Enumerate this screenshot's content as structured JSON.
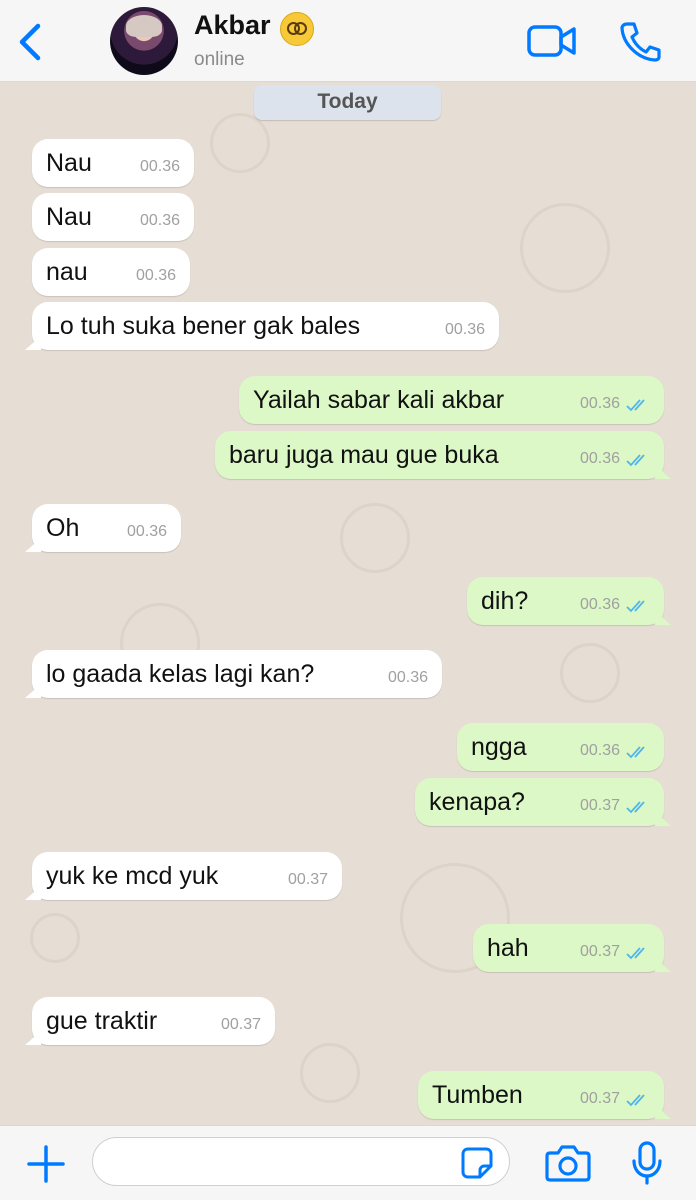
{
  "header": {
    "contact_name": "Akbar",
    "status": "online",
    "accent_color": "#007aff",
    "icons": [
      "chevron-left-icon",
      "avatar",
      "dizzy-face-emoji",
      "video-camera-icon",
      "phone-icon"
    ]
  },
  "chat": {
    "date_label": "Today",
    "messages": [
      {
        "direction": "in",
        "text": "Nau",
        "time": "00.36"
      },
      {
        "direction": "in",
        "text": "Nau",
        "time": "00.36"
      },
      {
        "direction": "in",
        "text": "nau",
        "time": "00.36"
      },
      {
        "direction": "in",
        "text": "Lo tuh suka bener gak bales",
        "time": "00.36"
      },
      {
        "direction": "out",
        "text": "Yailah sabar kali akbar",
        "time": "00.36",
        "read": true
      },
      {
        "direction": "out",
        "text": "baru juga mau gue buka",
        "time": "00.36",
        "read": true
      },
      {
        "direction": "in",
        "text": "Oh",
        "time": "00.36"
      },
      {
        "direction": "out",
        "text": "dih?",
        "time": "00.36",
        "read": true
      },
      {
        "direction": "in",
        "text": "lo gaada kelas lagi kan?",
        "time": "00.36"
      },
      {
        "direction": "out",
        "text": "ngga",
        "time": "00.36",
        "read": true
      },
      {
        "direction": "out",
        "text": "kenapa?",
        "time": "00.37",
        "read": true
      },
      {
        "direction": "in",
        "text": "yuk ke mcd yuk",
        "time": "00.37"
      },
      {
        "direction": "out",
        "text": "hah",
        "time": "00.37",
        "read": true
      },
      {
        "direction": "in",
        "text": "gue traktir",
        "time": "00.37"
      },
      {
        "direction": "out",
        "text": "Tumben",
        "time": "00.37",
        "read": true
      }
    ],
    "colors": {
      "background": "#e6ddd4",
      "incoming_bubble": "#ffffff",
      "outgoing_bubble": "#dcf8c6",
      "read_ticks": "#4fb6ec"
    }
  },
  "composer": {
    "input_value": "",
    "icons": [
      "plus-icon",
      "sticker-icon",
      "camera-icon",
      "microphone-icon"
    ]
  }
}
